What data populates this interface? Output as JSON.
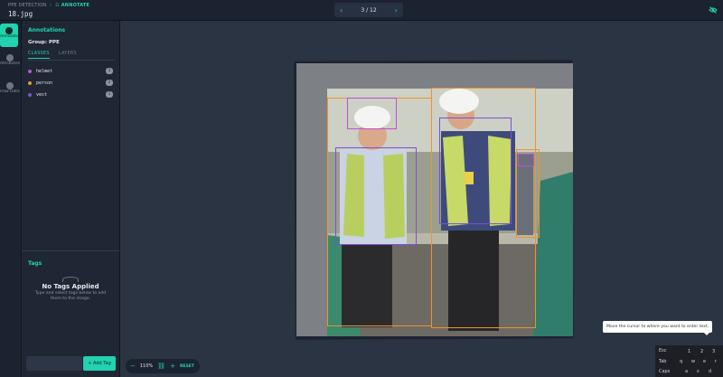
{
  "topbar": {
    "project": "PPE DETECTION",
    "mode": "ANNOTATE",
    "filename": "18.jpg",
    "pager": {
      "prev": "‹",
      "label": "3 / 12",
      "next": "›"
    }
  },
  "rail": [
    {
      "label": "Annotations",
      "active": true
    },
    {
      "label": "Attributes",
      "active": false
    },
    {
      "label": "Raw Data",
      "active": false
    }
  ],
  "annotations": {
    "title": "Annotations",
    "group": "Group: PPE",
    "tabs": {
      "classes": "CLASSES",
      "layers": "LAYERS"
    },
    "classes": [
      {
        "name": "helmet",
        "color": "#c04fd6",
        "count": "1"
      },
      {
        "name": "person",
        "color": "#f0932b",
        "count": "2"
      },
      {
        "name": "vest",
        "color": "#7b4fd6",
        "count": "1"
      }
    ]
  },
  "tags": {
    "title": "Tags",
    "empty_title": "No Tags Applied",
    "empty_text": "Type and select tags below to add them to the image.",
    "input_placeholder": "",
    "add_label": "+ Add Tag"
  },
  "zoom": {
    "minus": "−",
    "level": "110%",
    "plus": "+",
    "reset": "RESET"
  },
  "tooltip": "Move the cursor to where you want to enter text.",
  "keyboard": {
    "row1": [
      "Esc",
      "1",
      "2",
      "3"
    ],
    "row2": [
      "Tab",
      "q",
      "w",
      "e",
      "r"
    ],
    "row3": [
      "Caps",
      "a",
      "s",
      "d"
    ]
  },
  "colors": {
    "accent": "#21d3b0",
    "helmet": "#c04fd6",
    "person": "#f0932b",
    "vest": "#7b4fd6"
  }
}
